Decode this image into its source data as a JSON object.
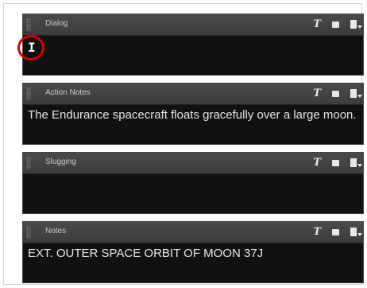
{
  "panels": [
    {
      "title": "Dialog",
      "content": ""
    },
    {
      "title": "Action Notes",
      "content": "The Endurance spacecraft floats gracefully over a large moon."
    },
    {
      "title": "Slugging",
      "content": ""
    },
    {
      "title": "Notes",
      "content": "EXT. OUTER SPACE ORBIT OF MOON 37J"
    }
  ],
  "icons": {
    "font": "text-style-icon",
    "doc": "note-icon",
    "export": "export-dropdown-icon"
  },
  "colors": {
    "header": "#3c3c3c",
    "content_bg": "#111111",
    "text": "#e7e7e7",
    "highlight": "#d40000"
  }
}
